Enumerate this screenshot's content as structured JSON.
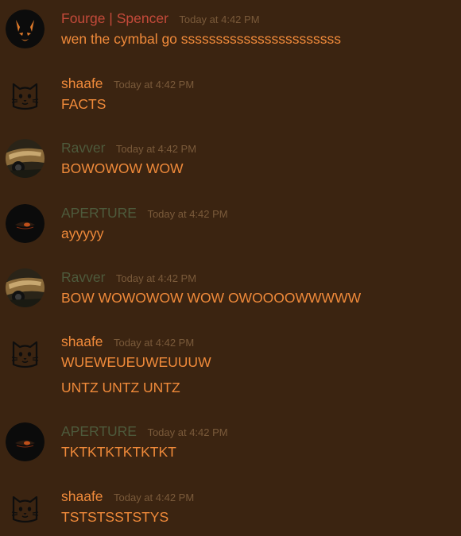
{
  "colors": {
    "background": "#3b2411",
    "message_text": "#f08a3a",
    "timestamp": "#7a5a3a",
    "user_fourge": "#c44a3a",
    "user_shaafe": "#f08a3a",
    "user_ravver": "#4d5a3c",
    "user_aperture": "#4d5a3c"
  },
  "messages": [
    {
      "username": "Fourge | Spencer",
      "timestamp": "Today at 4:42 PM",
      "avatar_icon": "horned-mask-icon",
      "lines": [
        "wen the cymbal go sssssssssssssssssssssss"
      ]
    },
    {
      "username": "shaafe",
      "timestamp": "Today at 4:42 PM",
      "avatar_icon": "cat-face-icon",
      "lines": [
        "FACTS"
      ]
    },
    {
      "username": "Ravver",
      "timestamp": "Today at 4:42 PM",
      "avatar_icon": "car-photo-icon",
      "lines": [
        "BOWOWOW WOW"
      ]
    },
    {
      "username": "APERTURE",
      "timestamp": "Today at 4:42 PM",
      "avatar_icon": "dark-eye-icon",
      "lines": [
        "ayyyyy"
      ]
    },
    {
      "username": "Ravver",
      "timestamp": "Today at 4:42 PM",
      "avatar_icon": "car-photo-icon",
      "lines": [
        "BOW WOWOWOW WOW OWOOOOWWWWW"
      ]
    },
    {
      "username": "shaafe",
      "timestamp": "Today at 4:42 PM",
      "avatar_icon": "cat-face-icon",
      "lines": [
        "WUEWEUEUWEUUUW",
        "UNTZ UNTZ UNTZ"
      ]
    },
    {
      "username": "APERTURE",
      "timestamp": "Today at 4:42 PM",
      "avatar_icon": "dark-eye-icon",
      "lines": [
        "TKTKTKTKTKTKT"
      ]
    },
    {
      "username": "shaafe",
      "timestamp": "Today at 4:42 PM",
      "avatar_icon": "cat-face-icon",
      "lines": [
        "TSTSTSSTSTYS"
      ]
    }
  ]
}
